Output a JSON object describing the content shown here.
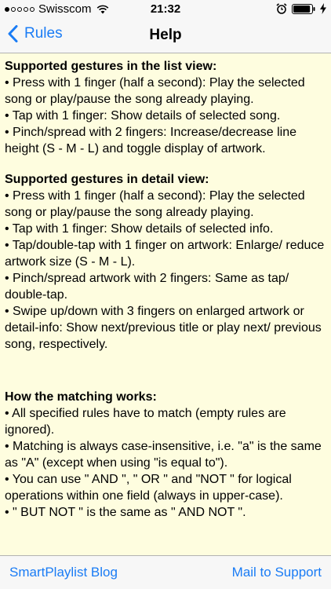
{
  "status_bar": {
    "carrier": "Swisscom",
    "time": "21:32",
    "signal_filled": 1,
    "signal_total": 5,
    "battery_level": 0.92
  },
  "nav": {
    "back_label": "Rules",
    "title": "Help"
  },
  "content": {
    "list_view": {
      "title": "Supported gestures in the list view:",
      "items": [
        "• Press with 1 finger (half a second): Play the selected song or play/pause the song already playing.",
        "• Tap with 1 finger: Show  details of selected song.",
        "• Pinch/spread with 2 fingers: Increase/decrease line height (S - M - L) and toggle display of artwork."
      ]
    },
    "detail_view": {
      "title": "Supported gestures in detail view:",
      "items": [
        "• Press with 1 finger (half a second): Play the selected song or play/pause the song already playing.",
        "• Tap with 1 finger: Show details of selected info.",
        "• Tap/double-tap with 1 finger on artwork: Enlarge/ reduce artwork size (S - M - L).",
        "• Pinch/spread artwork with 2 fingers: Same as tap/ double-tap.",
        "• Swipe up/down with 3 fingers on enlarged artwork or detail-info: Show next/previous title or play next/ previous song, respectively."
      ]
    },
    "matching": {
      "title": "How the matching works:",
      "items": [
        "• All specified rules have to match (empty rules are ignored).",
        "• Matching is always case-insensitive, i.e. \"a\" is the same as \"A\" (except when using \"is equal to\").",
        "• You can use \" AND \", \" OR \" and \"NOT \" for logical operations within one field (always in upper-case).",
        "• \" BUT NOT \" is the same as \" AND NOT \"."
      ]
    }
  },
  "toolbar": {
    "left_label": "SmartPlaylist Blog",
    "right_label": "Mail to Support"
  },
  "colors": {
    "accent": "#1a7cf5",
    "content_background": "#fefddf",
    "bar_background": "#f7f7f7"
  },
  "icons": [
    "wifi-icon",
    "alarm-icon",
    "battery-icon",
    "charging-icon",
    "back-chevron-icon"
  ]
}
